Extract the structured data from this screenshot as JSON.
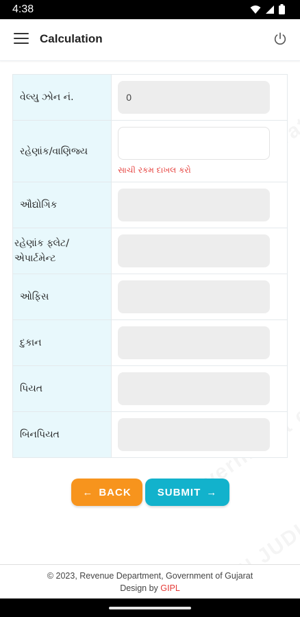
{
  "status_bar": {
    "time": "4:38"
  },
  "app_bar": {
    "title": "Calculation",
    "menu_icon": "hamburger-menu-icon",
    "power_icon": "power-icon"
  },
  "watermark": {
    "lines": [
      "NON JUDICIAL",
      "of Gujarat",
      "NON JUDICIAL",
      "Government of Gujarat"
    ]
  },
  "form": {
    "rows": [
      {
        "label": "વેલ્યુ ઝોન નં.",
        "value": "0"
      },
      {
        "label": "રહેણાંક/વાણિજ્ય",
        "value": "",
        "error": "સાચી રકમ દાખલ કરો"
      },
      {
        "label": "ઔદ્યોગિક",
        "value": ""
      },
      {
        "label": "રહેણાંક ફ્લેટ/એપાર્ટમેન્ટ",
        "value": ""
      },
      {
        "label": "ઓફિસ",
        "value": ""
      },
      {
        "label": "દુકાન",
        "value": ""
      },
      {
        "label": "પિયત",
        "value": ""
      },
      {
        "label": "બિનપિયત",
        "value": ""
      }
    ]
  },
  "buttons": {
    "back": "BACK",
    "submit": "SUBMIT"
  },
  "footer": {
    "copyright": "© 2023, Revenue Department, Government of Gujarat",
    "design_by": "Design by",
    "design_company": "GIPL"
  },
  "colors": {
    "back_button": "#f7941d",
    "submit_button": "#12b2cc",
    "label_bg": "#e8f8fc",
    "error": "#e53935"
  }
}
